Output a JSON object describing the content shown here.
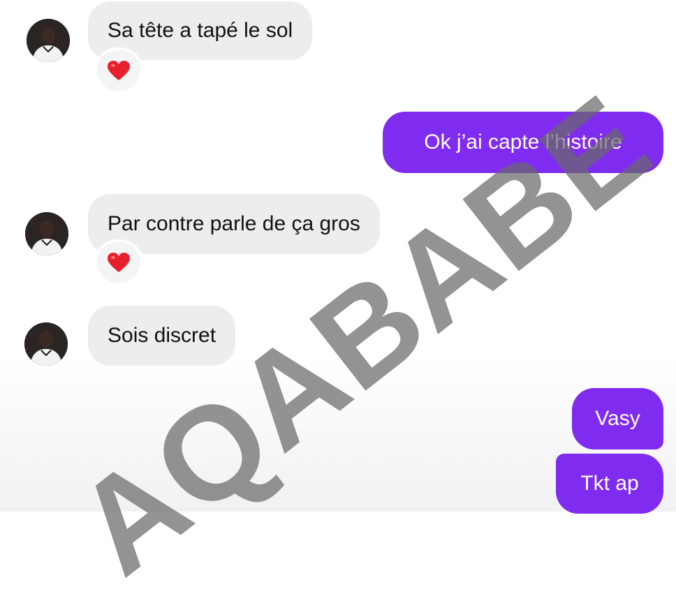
{
  "conversation": {
    "messages": [
      {
        "direction": "incoming",
        "text": "Sa tête a tapé le sol",
        "reaction": "heart"
      },
      {
        "direction": "outgoing",
        "text": "Ok j’ai capte l’histoire"
      },
      {
        "direction": "incoming",
        "text": "Par contre parle de ça gros",
        "reaction": "heart"
      },
      {
        "direction": "incoming",
        "text": "Sois discret"
      },
      {
        "direction": "outgoing",
        "text": "Vasy"
      },
      {
        "direction": "outgoing",
        "text": "Tkt ap"
      }
    ]
  },
  "watermark": {
    "text": "AQABABE"
  },
  "colors": {
    "outgoing_bubble": "#7f2cf0",
    "incoming_bubble": "#ededf0",
    "reaction_heart": "#e8202e",
    "watermark": "#696969"
  },
  "icons": {
    "reaction": "red-heart-icon",
    "avatar": "contact-avatar"
  }
}
